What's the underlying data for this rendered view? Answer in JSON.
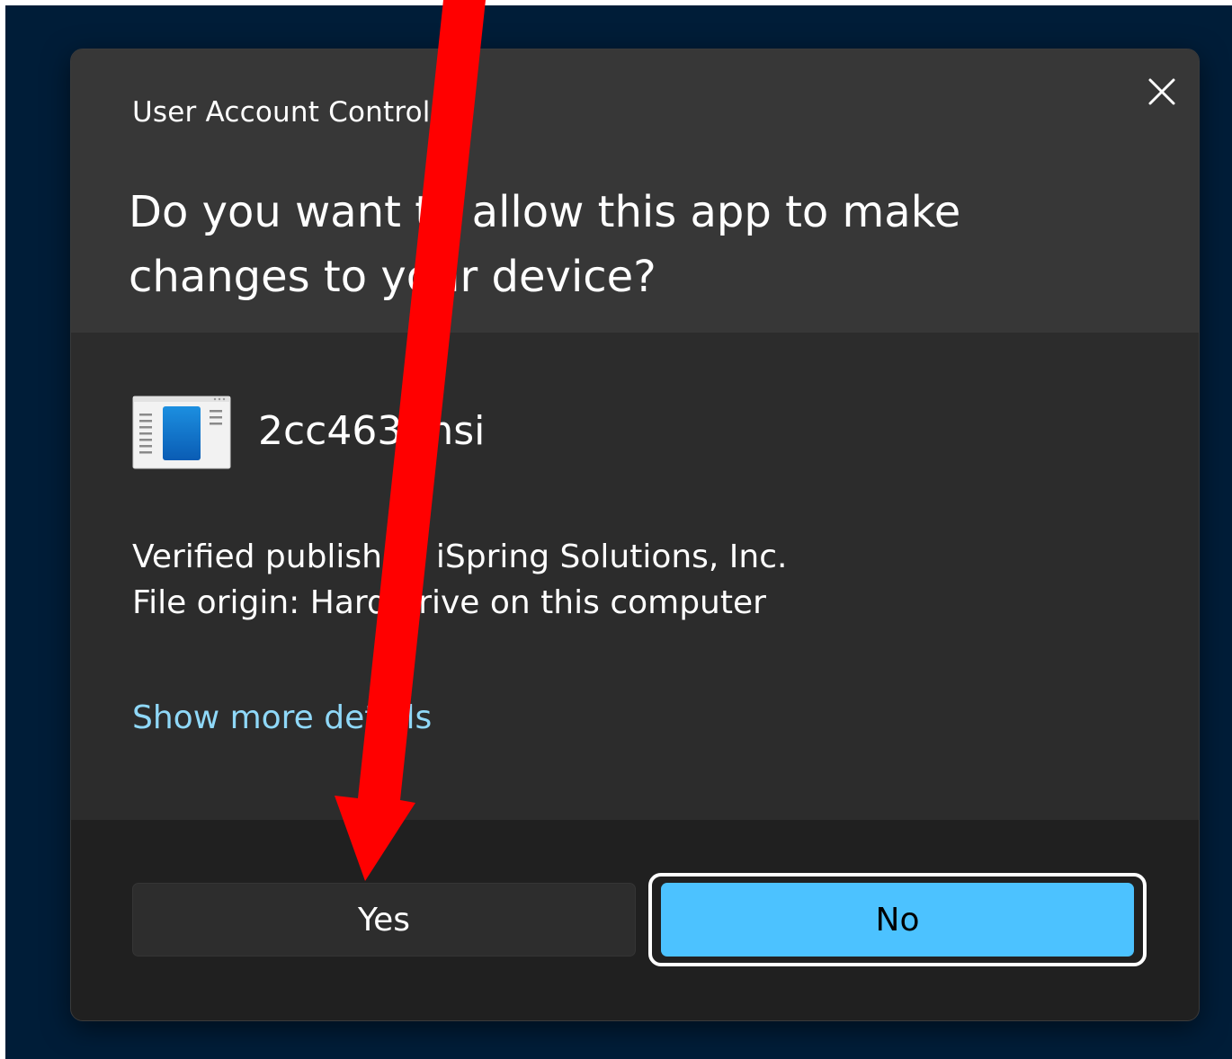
{
  "dialog": {
    "window_title": "User Account Control",
    "question": "Do you want to allow this app to make changes to your device?",
    "app_name": "2cc463.msi",
    "publisher_line": "Verified publisher: iSpring Solutions, Inc.",
    "origin_line": "File origin: Hard drive on this computer",
    "details_link": "Show more details",
    "yes_label": "Yes",
    "no_label": "No",
    "close_icon": "close-icon",
    "app_icon": "installer-app-icon"
  },
  "colors": {
    "desktop_bg": "#001d38",
    "header_bg": "#373737",
    "body_bg": "#2c2c2c",
    "footer_bg": "#202020",
    "link": "#8fd8f8",
    "no_button": "#4cc2ff",
    "annotation_arrow": "#ff0000"
  }
}
